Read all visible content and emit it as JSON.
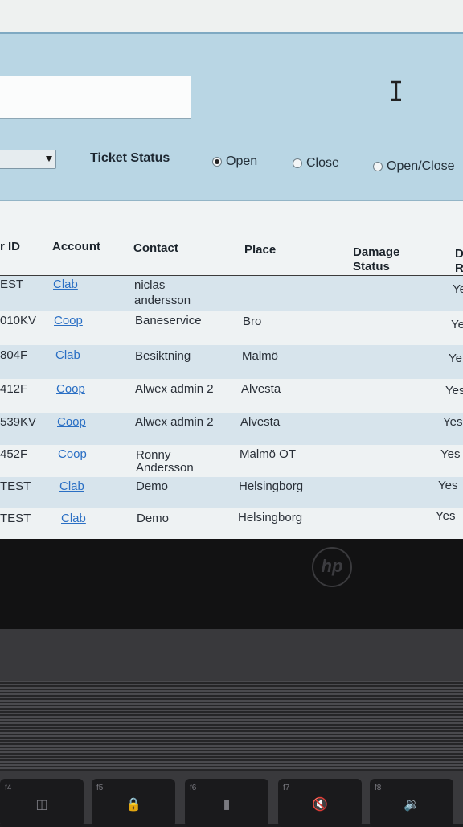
{
  "filters": {
    "search_value": "",
    "select_value": "",
    "ticket_status_label": "Ticket Status",
    "options": [
      {
        "label": "Open",
        "checked": true
      },
      {
        "label": "Close",
        "checked": false
      },
      {
        "label": "Open/Close",
        "checked": false
      }
    ]
  },
  "table": {
    "headers": {
      "id": "r ID",
      "account": "Account",
      "contact": "Contact",
      "place": "Place",
      "damage_1": "Damage",
      "damage_2": "Status",
      "last_1": "D",
      "last_2": "R"
    },
    "rows": [
      {
        "id": "EST",
        "account": "Clab",
        "contact": "niclas",
        "contact2": "andersson",
        "place": "",
        "last": "Ye"
      },
      {
        "id": "010KV",
        "account": "Coop",
        "contact": "Baneservice",
        "contact2": "",
        "place": "Bro",
        "last": "Ye"
      },
      {
        "id": "804F",
        "account": "Clab",
        "contact": "Besiktning",
        "contact2": "",
        "place": "Malmö",
        "last": "Ye"
      },
      {
        "id": "412F",
        "account": "Coop",
        "contact": "Alwex admin 2",
        "contact2": "",
        "place": "Alvesta",
        "last": "Yes"
      },
      {
        "id": "539KV",
        "account": "Coop",
        "contact": "Alwex admin 2",
        "contact2": "",
        "place": "Alvesta",
        "last": "Yes"
      },
      {
        "id": "452F",
        "account": "Coop",
        "contact": "Ronny",
        "contact2": "Andersson",
        "place": "Malmö OT",
        "last": "Yes"
      },
      {
        "id": "TEST",
        "account": "Clab",
        "contact": "Demo",
        "contact2": "",
        "place": "Helsingborg",
        "last": "Yes"
      },
      {
        "id": "TEST",
        "account": "Clab",
        "contact": "Demo",
        "contact2": "",
        "place": "Helsingborg",
        "last": "Yes"
      }
    ]
  },
  "device": {
    "brand": "hp",
    "keys": [
      {
        "label": "f4",
        "icon": "window-switch-icon"
      },
      {
        "label": "f5",
        "icon": "lock-icon"
      },
      {
        "label": "f6",
        "icon": "battery-icon"
      },
      {
        "label": "f7",
        "icon": "mute-icon"
      },
      {
        "label": "f8",
        "icon": "volume-down-icon"
      }
    ]
  }
}
